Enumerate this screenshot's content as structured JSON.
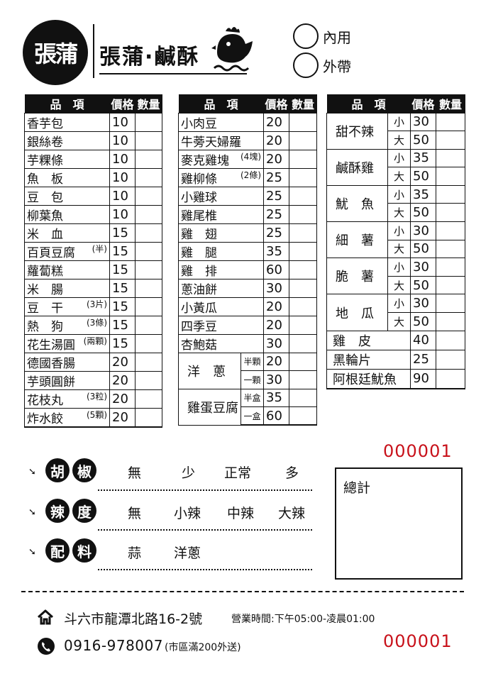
{
  "brand": {
    "name": "張蒲·鹹酥"
  },
  "order_type": [
    {
      "label": "內用"
    },
    {
      "label": "外帶"
    }
  ],
  "columns": [
    "品　項",
    "價格",
    "數量"
  ],
  "menu1": [
    {
      "name": "香芋包",
      "price": "10"
    },
    {
      "name": "銀絲卷",
      "price": "10"
    },
    {
      "name": "芋粿條",
      "price": "10"
    },
    {
      "name": "魚　板",
      "price": "10"
    },
    {
      "name": "豆　包",
      "price": "10"
    },
    {
      "name": "柳葉魚",
      "price": "10"
    },
    {
      "name": "米　血",
      "price": "15"
    },
    {
      "name": "百頁豆腐",
      "note": "(半)",
      "price": "15"
    },
    {
      "name": "蘿蔔糕",
      "price": "15"
    },
    {
      "name": "米　腸",
      "price": "15"
    },
    {
      "name": "豆　干",
      "note": "(3片)",
      "price": "15"
    },
    {
      "name": "熱　狗",
      "note": "(3條)",
      "price": "15"
    },
    {
      "name": "花生湯圓",
      "note": "(兩顆)",
      "price": "15"
    },
    {
      "name": "德國香腸",
      "price": "20"
    },
    {
      "name": "芋頭圓餅",
      "price": "20"
    },
    {
      "name": "花枝丸",
      "note": "(3粒)",
      "price": "20"
    },
    {
      "name": "炸水餃",
      "note": "(5顆)",
      "price": "20"
    }
  ],
  "menu2": [
    {
      "name": "小肉豆",
      "price": "20"
    },
    {
      "name": "牛蒡天婦羅",
      "price": "20"
    },
    {
      "name": "麥克雞塊",
      "note": "(4塊)",
      "price": "20"
    },
    {
      "name": "雞柳條",
      "note": "(2條)",
      "price": "25"
    },
    {
      "name": "小雞球",
      "price": "25"
    },
    {
      "name": "雞尾椎",
      "price": "25"
    },
    {
      "name": "雞　翅",
      "price": "25"
    },
    {
      "name": "雞　腿",
      "price": "35"
    },
    {
      "name": "雞　排",
      "price": "60"
    },
    {
      "name": "蔥油餅",
      "price": "30"
    },
    {
      "name": "小黃瓜",
      "price": "20"
    },
    {
      "name": "四季豆",
      "price": "20"
    },
    {
      "name": "杏鮑菇",
      "price": "30"
    }
  ],
  "menu2_groups": [
    {
      "name": "洋　蔥",
      "sizes": [
        {
          "size": "半顆",
          "price": "20"
        },
        {
          "size": "一顆",
          "price": "30"
        }
      ]
    },
    {
      "name": "雞蛋豆腐",
      "sizes": [
        {
          "size": "半盒",
          "price": "35"
        },
        {
          "size": "一盒",
          "price": "60"
        }
      ]
    }
  ],
  "menu3_groups": [
    {
      "name": "甜不辣",
      "sizes": [
        {
          "size": "小",
          "price": "30"
        },
        {
          "size": "大",
          "price": "50"
        }
      ]
    },
    {
      "name": "鹹酥雞",
      "sizes": [
        {
          "size": "小",
          "price": "35"
        },
        {
          "size": "大",
          "price": "50"
        }
      ]
    },
    {
      "name": "魷　魚",
      "sizes": [
        {
          "size": "小",
          "price": "35"
        },
        {
          "size": "大",
          "price": "50"
        }
      ]
    },
    {
      "name": "細　薯",
      "sizes": [
        {
          "size": "小",
          "price": "30"
        },
        {
          "size": "大",
          "price": "50"
        }
      ]
    },
    {
      "name": "脆　薯",
      "sizes": [
        {
          "size": "小",
          "price": "30"
        },
        {
          "size": "大",
          "price": "50"
        }
      ]
    },
    {
      "name": "地　瓜",
      "sizes": [
        {
          "size": "小",
          "price": "30"
        },
        {
          "size": "大",
          "price": "50"
        }
      ]
    }
  ],
  "menu3_items": [
    {
      "name": "雞　皮",
      "price": "40"
    },
    {
      "name": "黑輪片",
      "price": "25"
    },
    {
      "name": "阿根廷魷魚",
      "price": "90"
    }
  ],
  "serial": "000001",
  "options": [
    {
      "c1": "胡",
      "c2": "椒",
      "choices": [
        "無",
        "少",
        "正常",
        "多"
      ]
    },
    {
      "c1": "辣",
      "c2": "度",
      "choices": [
        "無",
        "小辣",
        "中辣",
        "大辣"
      ]
    },
    {
      "c1": "配",
      "c2": "料",
      "choices": [
        "蒜",
        "洋蔥"
      ]
    }
  ],
  "total_label": "總計",
  "footer": {
    "address": "斗六市龍潭北路16-2號",
    "hours": "營業時間:下午05:00-凌晨01:00",
    "phone": "0916-978007",
    "delivery": "(市區滿200外送)"
  }
}
